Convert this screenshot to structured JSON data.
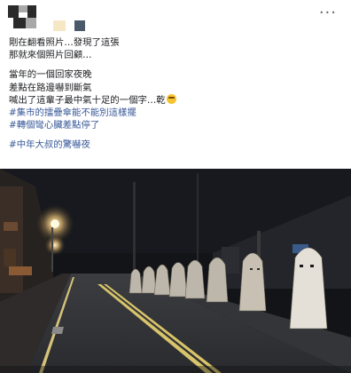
{
  "post": {
    "author_avatar": "avatar",
    "more_icon": "more-dots-icon",
    "more_label": "···",
    "lines": [
      "剛在翻看照片…發現了這張",
      "那就來個照片回顧…"
    ],
    "lines2": [
      "當年的一個回家夜晚",
      "差點在路邊嚇到斷氣",
      "喊出了這輩子最中氣十足的一個字…乾"
    ],
    "hashtags": [
      "#集市的擂疊傘能不能別這樣擺",
      "#轉個彎心臟差點停了"
    ],
    "hashtag_last": "#中年大叔的驚嚇夜",
    "emoji": "grimacing-face"
  },
  "colors": {
    "link": "#385898",
    "text": "#1c1e21",
    "muted": "#606770"
  }
}
